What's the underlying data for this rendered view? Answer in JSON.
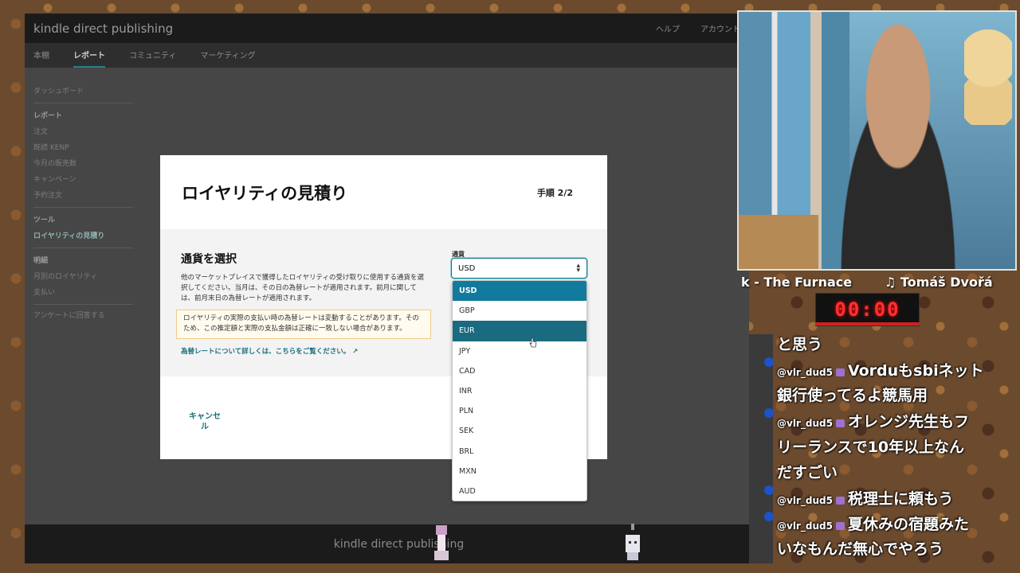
{
  "kdp": {
    "logo": "kindle direct publishing",
    "top_links": [
      "ヘルプ",
      "アカウント"
    ],
    "tabs": [
      {
        "label": "本棚",
        "active": false
      },
      {
        "label": "レポート",
        "active": true
      },
      {
        "label": "コミュニティ",
        "active": false
      },
      {
        "label": "マーケティング",
        "active": false
      }
    ],
    "sidebar": {
      "dashboard": "ダッシュボード",
      "reports_head": "レポート",
      "reports": [
        "注文",
        "既読 KENP",
        "今月の販売数",
        "キャンペーン",
        "予約注文"
      ],
      "tools_head": "ツール",
      "tools": [
        "ロイヤリティの見積り"
      ],
      "statements_head": "明細",
      "statements": [
        "月別のロイヤリティ",
        "支払い"
      ],
      "survey": "アンケートに回答する"
    },
    "footer_logo": "kindle direct publishing"
  },
  "modal": {
    "title": "ロイヤリティの見積り",
    "step": "手順 2/2",
    "section_title": "通貨を選択",
    "description": "他のマーケットプレイスで獲得したロイヤリティの受け取りに使用する通貨を選択してください。当月は、その日の為替レートが適用されます。前月に関しては、前月末日の為替レートが適用されます。",
    "alert": "ロイヤリティの実際の支払い時の為替レートは変動することがあります。そのため、この推定額と実際の支払金額は正確に一致しない場合があります。",
    "rate_link": "為替レートについて詳しくは、こちらをご覧ください。",
    "currency_label": "通貨",
    "currency_value": "USD",
    "cancel": "キャンセル"
  },
  "dropdown": {
    "options": [
      "USD",
      "GBP",
      "EUR",
      "JPY",
      "CAD",
      "INR",
      "PLN",
      "SEK",
      "BRL",
      "MXN",
      "AUD"
    ],
    "selected": "USD",
    "hovered": "EUR"
  },
  "stream": {
    "ticker_1": "k - The Furnace",
    "ticker_2": "♫ Tomáš Dvořá",
    "timer": "00:00",
    "chat": {
      "line1": "と思う",
      "msg1_user": "@vlr_dud5",
      "msg1_a": "Vorduもsbiネット",
      "msg1_b": "銀行使ってるよ競馬用",
      "msg2_user": "@vlr_dud5",
      "msg2_a": "オレンジ先生もフ",
      "msg2_b": "リーランスで10年以上なん",
      "msg2_c": "だすごい",
      "msg3_user": "@vlr_dud5",
      "msg3_a": "税理士に頼もう",
      "msg4_user": "@vlr_dud5",
      "msg4_a": "夏休みの宿題みた",
      "msg4_b": "いなもんだ無心でやろう"
    }
  },
  "colors": {
    "accent": "#127a9c",
    "link": "#1a6f7d",
    "timer": "#ff3030"
  }
}
